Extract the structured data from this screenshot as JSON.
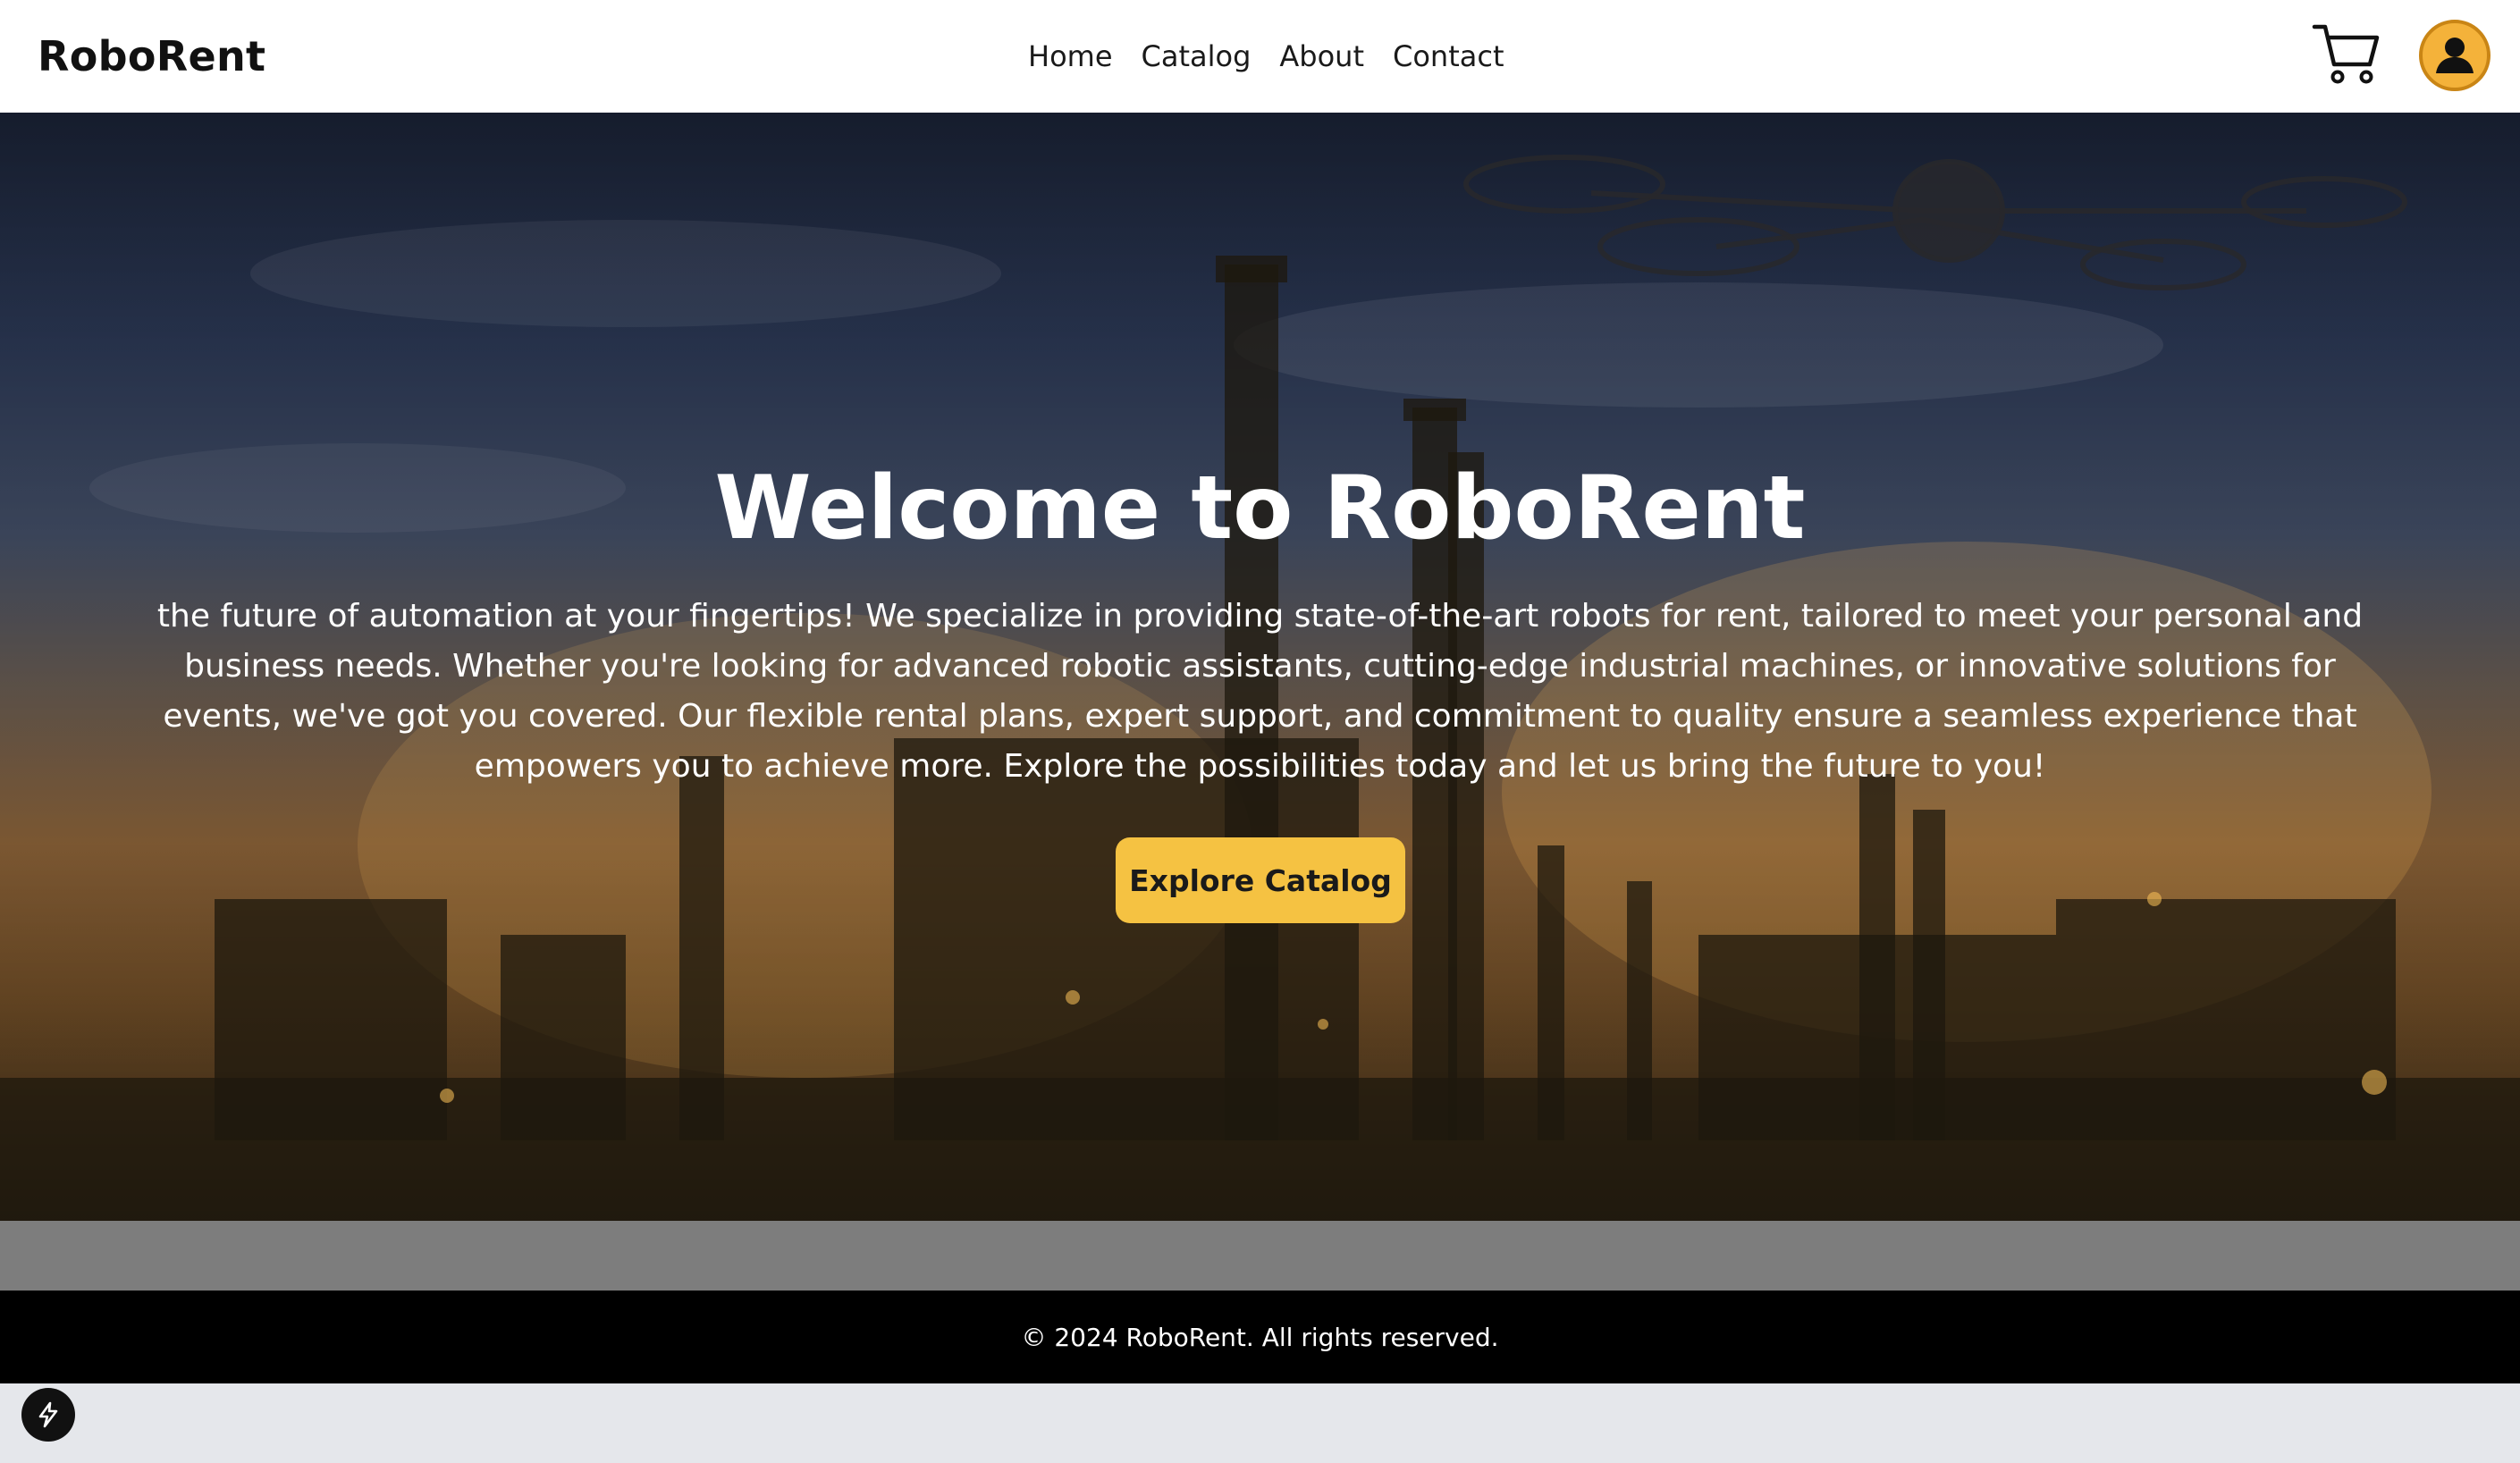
{
  "header": {
    "logo": "RoboRent",
    "nav": [
      {
        "label": "Home"
      },
      {
        "label": "Catalog"
      },
      {
        "label": "About"
      },
      {
        "label": "Contact"
      }
    ],
    "cart_icon": "shopping-cart-icon",
    "avatar_icon": "user-avatar-icon"
  },
  "hero": {
    "title": "Welcome to RoboRent",
    "text": "the future of automation at your fingertips! We specialize in providing state-of-the-art robots for rent, tailored to meet your personal and business needs. Whether you're looking for advanced robotic assistants, cutting-edge industrial machines, or innovative solutions for events, we've got you covered. Our flexible rental plans, expert support, and commitment to quality ensure a seamless experience that empowers you to achieve more. Explore the possibilities today and let us bring the future to you!",
    "cta_label": "Explore Catalog"
  },
  "footer": {
    "copyright": "© 2024 RoboRent. All rights reserved."
  },
  "colors": {
    "accent": "#f5c242",
    "avatar": "#f4b23a",
    "footer_bg": "#000000"
  }
}
